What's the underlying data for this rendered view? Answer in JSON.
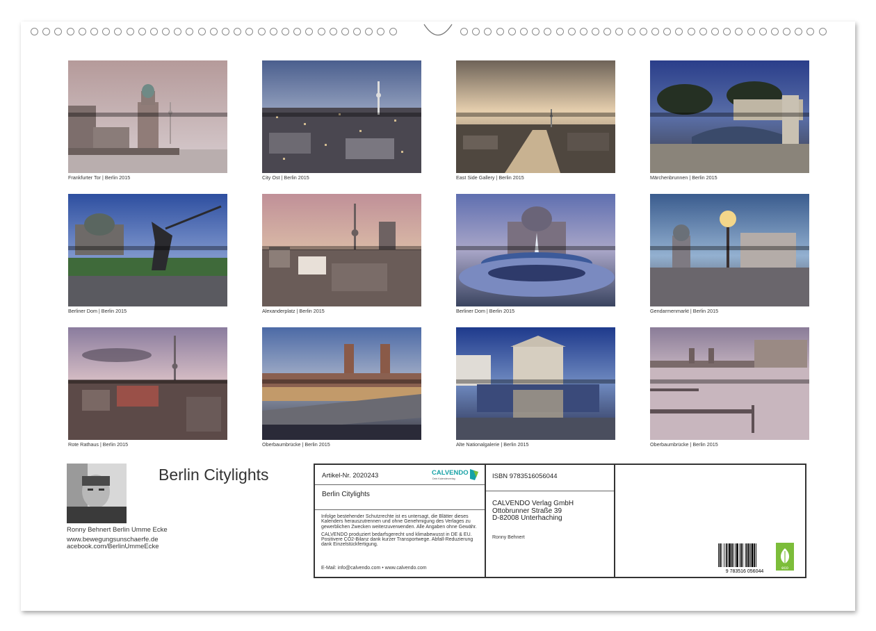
{
  "calendar": {
    "title": "Berlin Citylights",
    "photos": [
      {
        "caption": "Frankfurter Tor | Berlin 2015"
      },
      {
        "caption": "City Ost | Berlin 2015"
      },
      {
        "caption": "East Side Gallery | Berlin 2015"
      },
      {
        "caption": "Märchenbrunnen | Berlin 2015"
      },
      {
        "caption": "Berliner Dom | Berlin 2015"
      },
      {
        "caption": "Alexanderplatz | Berlin 2015"
      },
      {
        "caption": "Berliner Dom | Berlin 2015"
      },
      {
        "caption": "Gendarmenmarkt | Berlin 2015"
      },
      {
        "caption": "Rote Rathaus | Berlin 2015"
      },
      {
        "caption": "Oberbaumbrücke | Berlin 2015"
      },
      {
        "caption": "Alte Nationalgalerie | Berlin 2015"
      },
      {
        "caption": "Oberbaumbrücke | Berlin 2015"
      }
    ]
  },
  "author": {
    "line": "Ronny Behnert  Berlin Umme Ecke",
    "website": "www.bewegungsunschaerfe.de",
    "facebook": "acebook.com/BerlinUmmeEcke"
  },
  "imprint": {
    "article_number": "Artikel-Nr. 2020243",
    "logo_text": "CALVENDO",
    "logo_tagline": "Dein Kalenderverlag",
    "product_title": "Berlin Citylights",
    "legal_text": "Infolge bestehender Schutzrechte ist es untersagt, die Blätter dieses Kalenders herauszutrennen und ohne Genehmigung des Verlages zu gewerblichen Zwecken weiterzuverwenden. Alle Angaben ohne Gewähr.",
    "production_text": "CALVENDO produziert bedarfsgerecht und klimabewusst in DE & EU. Positivere CO2-Bilanz dank kurzer Transportwege. Abfall-Reduzierung dank Einzelstückfertigung.",
    "email": "E-Mail: info@calvendo.com • www.calvendo.com",
    "isbn": "ISBN 9783516056044",
    "publisher_name": "CALVENDO Verlag GmbH",
    "publisher_street": "Ottobrunner Straße 39",
    "publisher_city": "D-82008 Unterhaching",
    "photographer": "Ronny Behnert",
    "barcode_digits": "9 783516 056044",
    "eco_label": "eco"
  },
  "colors": {
    "accent_green": "#7cbd3a",
    "brand_teal": "#17a2a6"
  }
}
